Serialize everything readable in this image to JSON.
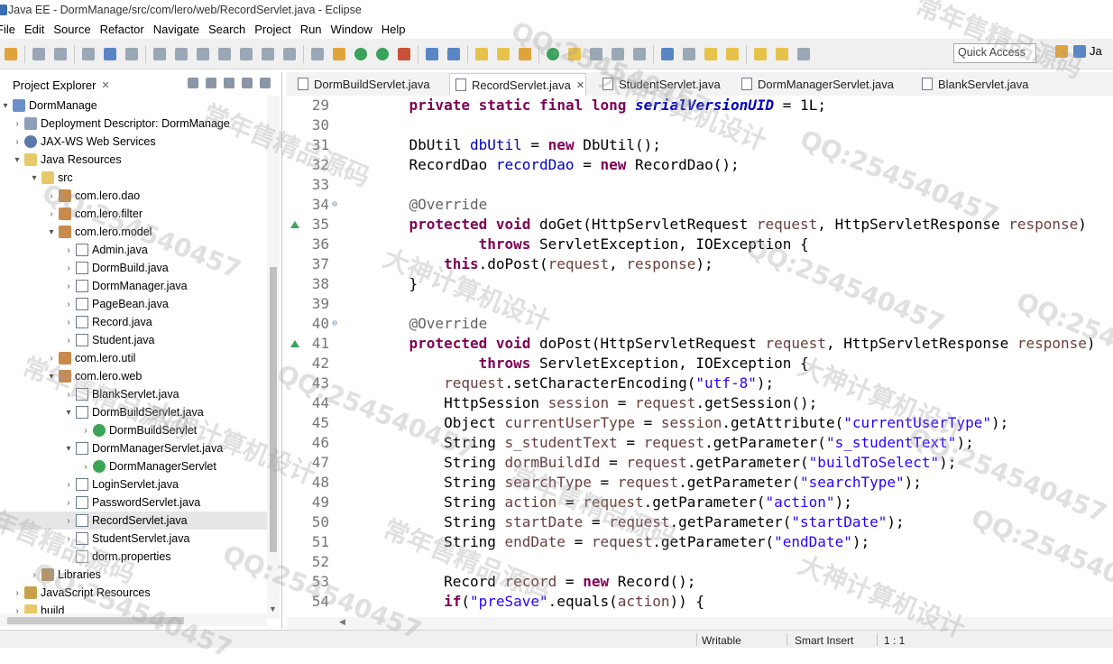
{
  "window": {
    "title": "Java EE - DormManage/src/com/lero/web/RecordServlet.java - Eclipse"
  },
  "menu": [
    "File",
    "Edit",
    "Source",
    "Refactor",
    "Navigate",
    "Search",
    "Project",
    "Run",
    "Window",
    "Help"
  ],
  "toolbar": {
    "quick_access": "Quick Access",
    "perspective": "Ja"
  },
  "explorer": {
    "title": "Project Explorer",
    "close": "✕",
    "tree": [
      {
        "label": "DormManage",
        "icon": "project-icon",
        "tw": "▾",
        "depth": 0
      },
      {
        "label": "Deployment Descriptor: DormManage",
        "icon": "descriptor-icon",
        "tw": "›",
        "depth": 1
      },
      {
        "label": "JAX-WS Web Services",
        "icon": "webservice-icon",
        "tw": "›",
        "depth": 1
      },
      {
        "label": "Java Resources",
        "icon": "java-resources-icon",
        "tw": "▾",
        "depth": 1
      },
      {
        "label": "src",
        "icon": "source-folder-icon",
        "tw": "▾",
        "depth": 2
      },
      {
        "label": "com.lero.dao",
        "icon": "package-icon",
        "tw": "›",
        "depth": 3
      },
      {
        "label": "com.lero.filter",
        "icon": "package-icon",
        "tw": "›",
        "depth": 3
      },
      {
        "label": "com.lero.model",
        "icon": "package-icon",
        "tw": "▾",
        "depth": 3
      },
      {
        "label": "Admin.java",
        "icon": "java-file-icon",
        "tw": "›",
        "depth": 4
      },
      {
        "label": "DormBuild.java",
        "icon": "java-file-icon",
        "tw": "›",
        "depth": 4
      },
      {
        "label": "DormManager.java",
        "icon": "java-file-icon",
        "tw": "›",
        "depth": 4
      },
      {
        "label": "PageBean.java",
        "icon": "java-file-icon",
        "tw": "›",
        "depth": 4
      },
      {
        "label": "Record.java",
        "icon": "java-file-icon",
        "tw": "›",
        "depth": 4
      },
      {
        "label": "Student.java",
        "icon": "java-file-icon",
        "tw": "›",
        "depth": 4
      },
      {
        "label": "com.lero.util",
        "icon": "package-icon",
        "tw": "›",
        "depth": 3
      },
      {
        "label": "com.lero.web",
        "icon": "package-icon",
        "tw": "▾",
        "depth": 3
      },
      {
        "label": "BlankServlet.java",
        "icon": "java-file-icon",
        "tw": "›",
        "depth": 4
      },
      {
        "label": "DormBuildServlet.java",
        "icon": "java-file-icon",
        "tw": "▾",
        "depth": 4
      },
      {
        "label": "DormBuildServlet",
        "icon": "class-icon",
        "tw": "›",
        "depth": 5
      },
      {
        "label": "DormManagerServlet.java",
        "icon": "java-file-icon",
        "tw": "▾",
        "depth": 4
      },
      {
        "label": "DormManagerServlet",
        "icon": "class-icon",
        "tw": "›",
        "depth": 5
      },
      {
        "label": "LoginServlet.java",
        "icon": "java-file-icon",
        "tw": "›",
        "depth": 4
      },
      {
        "label": "PasswordServlet.java",
        "icon": "java-file-icon",
        "tw": "›",
        "depth": 4
      },
      {
        "label": "RecordServlet.java",
        "icon": "java-file-icon",
        "tw": "›",
        "depth": 4,
        "selected": true
      },
      {
        "label": "StudentServlet.java",
        "icon": "java-file-icon",
        "tw": "›",
        "depth": 4
      },
      {
        "label": "dorm.properties",
        "icon": "properties-icon",
        "tw": "",
        "depth": 4
      },
      {
        "label": "Libraries",
        "icon": "libraries-icon",
        "tw": "›",
        "depth": 2
      },
      {
        "label": "JavaScript Resources",
        "icon": "js-resources-icon",
        "tw": "›",
        "depth": 1
      },
      {
        "label": "build",
        "icon": "folder-icon",
        "tw": "›",
        "depth": 1
      }
    ]
  },
  "editor": {
    "tabs": [
      {
        "label": "DormBuildServlet.java",
        "active": false
      },
      {
        "label": "RecordServlet.java",
        "active": true,
        "close": "✕"
      },
      {
        "label": "StudentServlet.java",
        "active": false
      },
      {
        "label": "DormManagerServlet.java",
        "active": false
      },
      {
        "label": "BlankServlet.java",
        "active": false
      }
    ],
    "lines": [
      {
        "n": "29",
        "code": "    private static final long serialVersionUID = 1L;"
      },
      {
        "n": "30",
        "code": ""
      },
      {
        "n": "31",
        "code": "    DbUtil dbUtil = new DbUtil();"
      },
      {
        "n": "32",
        "code": "    RecordDao recordDao = new RecordDao();"
      },
      {
        "n": "33",
        "code": ""
      },
      {
        "n": "34",
        "code": "    @Override",
        "fold": "⊖"
      },
      {
        "n": "35",
        "code": "    protected void doGet(HttpServletRequest request, HttpServletResponse response)",
        "override": true
      },
      {
        "n": "36",
        "code": "            throws ServletException, IOException {"
      },
      {
        "n": "37",
        "code": "        this.doPost(request, response);"
      },
      {
        "n": "38",
        "code": "    }"
      },
      {
        "n": "39",
        "code": ""
      },
      {
        "n": "40",
        "code": "    @Override",
        "fold": "⊖"
      },
      {
        "n": "41",
        "code": "    protected void doPost(HttpServletRequest request, HttpServletResponse response)",
        "override": true
      },
      {
        "n": "42",
        "code": "            throws ServletException, IOException {"
      },
      {
        "n": "43",
        "code": "        request.setCharacterEncoding(\"utf-8\");"
      },
      {
        "n": "44",
        "code": "        HttpSession session = request.getSession();"
      },
      {
        "n": "45",
        "code": "        Object currentUserType = session.getAttribute(\"currentUserType\");"
      },
      {
        "n": "46",
        "code": "        String s_studentText = request.getParameter(\"s_studentText\");"
      },
      {
        "n": "47",
        "code": "        String dormBuildId = request.getParameter(\"buildToSelect\");"
      },
      {
        "n": "48",
        "code": "        String searchType = request.getParameter(\"searchType\");"
      },
      {
        "n": "49",
        "code": "        String action = request.getParameter(\"action\");"
      },
      {
        "n": "50",
        "code": "        String startDate = request.getParameter(\"startDate\");"
      },
      {
        "n": "51",
        "code": "        String endDate = request.getParameter(\"endDate\");"
      },
      {
        "n": "52",
        "code": ""
      },
      {
        "n": "53",
        "code": "        Record record = new Record();"
      },
      {
        "n": "54",
        "code": "        if(\"preSave\".equals(action)) {"
      }
    ]
  },
  "status": {
    "mode": "Writable",
    "insert": "Smart Insert",
    "position": "1 : 1"
  },
  "watermarks": [
    "QQ:254540457",
    "常年售精品源码",
    "大神计算机设计"
  ]
}
